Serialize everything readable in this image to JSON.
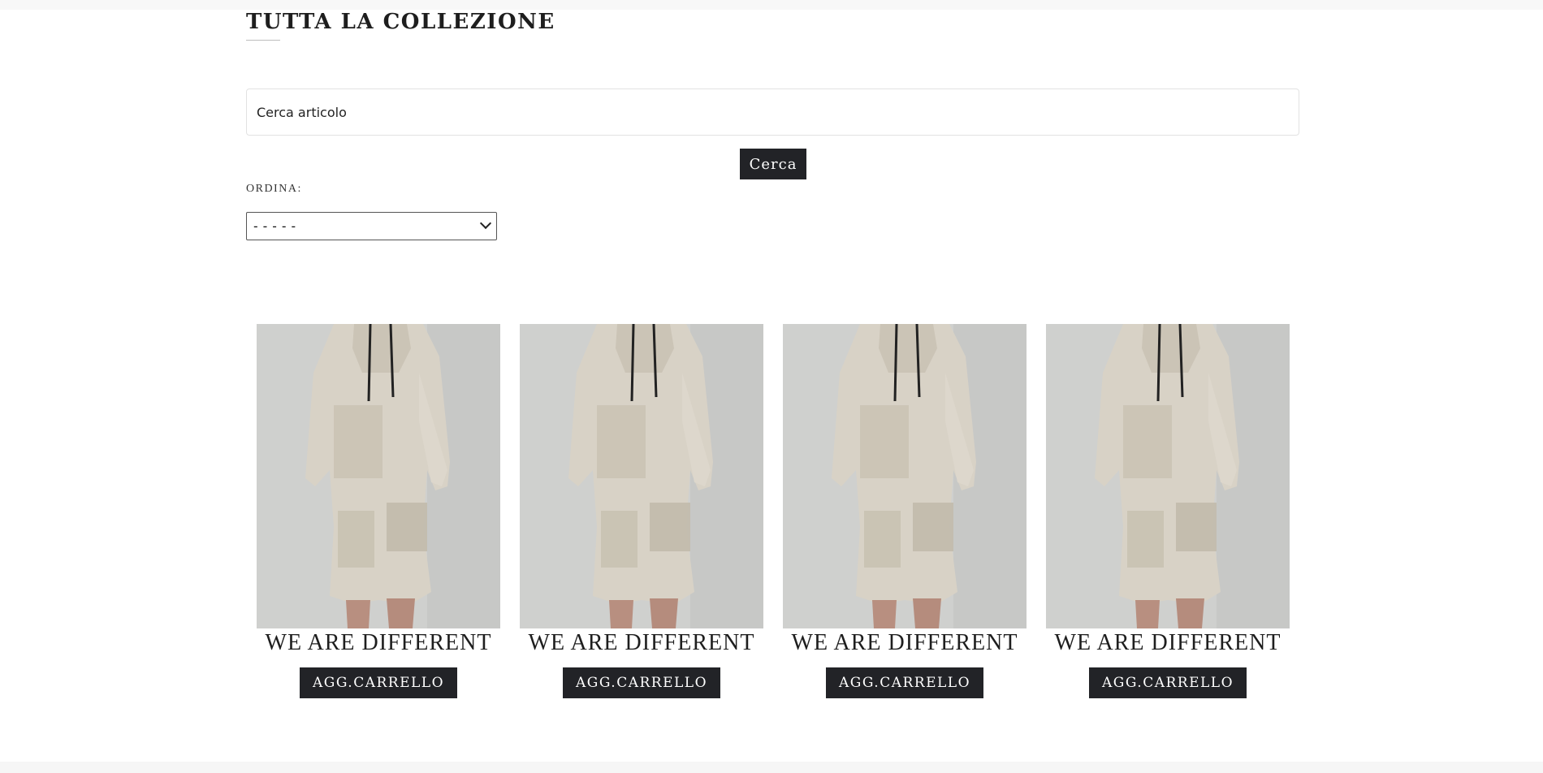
{
  "page": {
    "title": "TUTTA LA COLLEZIONE"
  },
  "search": {
    "placeholder": "Cerca articolo",
    "button_label": "Cerca"
  },
  "sort": {
    "label": "ORDINA:",
    "selected": "-----"
  },
  "products": [
    {
      "name": "WE ARE DIFFERENT",
      "cart_label": "AGG.CARRELLO",
      "image": "model-wearing-bandana-print-hoodie-and-shorts"
    },
    {
      "name": "WE ARE DIFFERENT",
      "cart_label": "AGG.CARRELLO",
      "image": "model-wearing-bandana-print-hoodie-and-shorts"
    },
    {
      "name": "WE ARE DIFFERENT",
      "cart_label": "AGG.CARRELLO",
      "image": "model-wearing-bandana-print-hoodie-and-shorts"
    },
    {
      "name": "WE ARE DIFFERENT",
      "cart_label": "AGG.CARRELLO",
      "image": "model-wearing-bandana-print-hoodie-and-shorts"
    }
  ],
  "colors": {
    "button_bg": "#222327",
    "button_text": "#ffffff",
    "garment": "#d8d2c6",
    "background": "#ffffff"
  }
}
